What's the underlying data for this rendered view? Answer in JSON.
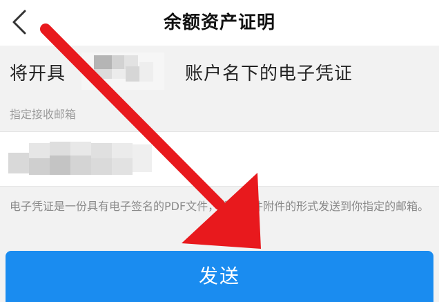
{
  "header": {
    "title": "余额资产证明",
    "back_icon": "chevron-left-icon"
  },
  "issue_line": {
    "prefix": "将开具",
    "suffix": "账户名下的电子凭证"
  },
  "email": {
    "label": "指定接收邮箱"
  },
  "description": "电子凭证是一份具有电子签名的PDF文件，将以邮件附件的形式发送到你指定的邮箱。",
  "actions": {
    "send_label": "发送"
  },
  "colors": {
    "primary_button": "#1a8cf0",
    "arrow": "#e8191d",
    "muted_text": "#8a8a8a"
  }
}
